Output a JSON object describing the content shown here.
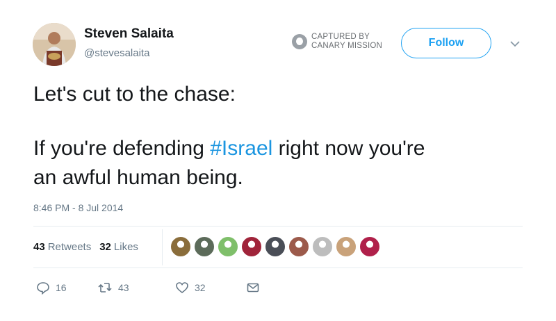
{
  "profile": {
    "name": "Steven Salaita",
    "handle": "@stevesalaita"
  },
  "watermark": {
    "line1": "CAPTURED BY",
    "line2": "CANARY MISSION"
  },
  "follow_label": "Follow",
  "tweet": {
    "line1": "Let's cut to the chase:",
    "line2_pre": "If you're defending ",
    "hashtag": "#Israel",
    "line2_post": " right now you're",
    "line3": "an awful human being."
  },
  "timestamp": "8:46 PM - 8 Jul 2014",
  "stats": {
    "retweets_count": "43",
    "retweets_label": "Retweets",
    "likes_count": "32",
    "likes_label": "Likes"
  },
  "liker_colors": [
    "#8a6d3b",
    "#5c6b5a",
    "#7fbf6a",
    "#a0243a",
    "#4a4e57",
    "#9c5a4b",
    "#bdbdbd",
    "#c9a27a",
    "#b0204a"
  ],
  "actions": {
    "reply_count": "16",
    "retweet_count": "43",
    "like_count": "32"
  },
  "colors": {
    "accent": "#1da1f2",
    "hashtag": "#1b95e0",
    "muted": "#657786"
  }
}
